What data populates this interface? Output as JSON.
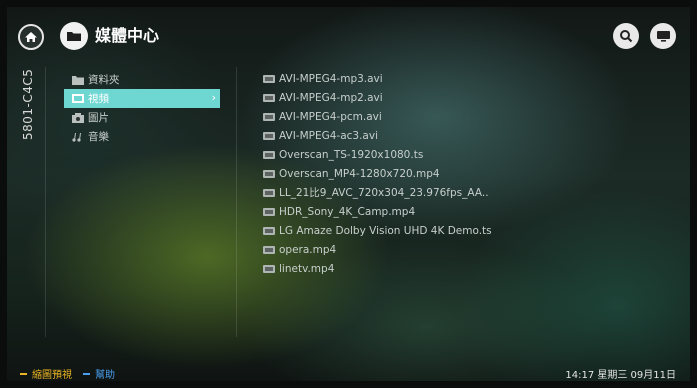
{
  "header": {
    "title": "媒體中心",
    "home_icon": "home-icon",
    "title_icon": "folder-icon",
    "search_icon": "search-icon",
    "device_icon": "tv-screen-icon"
  },
  "device_label": "5801-C4C5",
  "categories": [
    {
      "label": "資料夾",
      "icon": "folder-icon"
    },
    {
      "label": "視頻",
      "icon": "video-icon",
      "selected": true
    },
    {
      "label": "圖片",
      "icon": "photo-icon"
    },
    {
      "label": "音樂",
      "icon": "music-icon"
    }
  ],
  "files": [
    {
      "name": "AVI-MPEG4-mp3.avi"
    },
    {
      "name": "AVI-MPEG4-mp2.avi"
    },
    {
      "name": "AVI-MPEG4-pcm.avi"
    },
    {
      "name": "AVI-MPEG4-ac3.avi"
    },
    {
      "name": "Overscan_TS-1920x1080.ts"
    },
    {
      "name": "Overscan_MP4-1280x720.mp4"
    },
    {
      "name": "LL_21比9_AVC_720x304_23.976fps_AA.."
    },
    {
      "name": "HDR_Sony_4K_Camp.mp4"
    },
    {
      "name": "LG Amaze Dolby Vision UHD 4K Demo.ts"
    },
    {
      "name": "opera.mp4"
    },
    {
      "name": "linetv.mp4"
    }
  ],
  "footer": {
    "hint_yellow": "縮圖預視",
    "hint_blue": "幫助",
    "clock": "14:17  星期三 09月11日"
  },
  "colors": {
    "accent_selected": "#6fd7d2",
    "hint_yellow": "#e8b423",
    "hint_blue": "#4a9ff0"
  }
}
